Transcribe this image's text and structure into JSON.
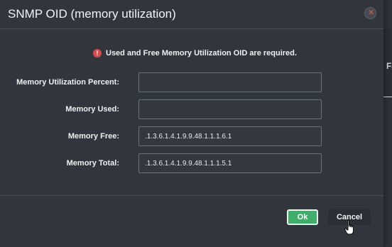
{
  "background": {
    "partial_text": "Fa"
  },
  "dialog": {
    "title": "SNMP OID (memory utilization)",
    "close_icon": "close-icon",
    "alert": {
      "icon": "error-icon",
      "text": "Used and Free Memory Utilization OID are required."
    },
    "fields": [
      {
        "label": "Memory Utilization Percent:",
        "value": ""
      },
      {
        "label": "Memory Used:",
        "value": ""
      },
      {
        "label": "Memory Free:",
        "value": ".1.3.6.1.4.1.9.9.48.1.1.1.6.1"
      },
      {
        "label": "Memory Total:",
        "value": ".1.3.6.1.4.1.9.9.48.1.1.1.5.1"
      }
    ],
    "buttons": {
      "ok_label": "Ok",
      "cancel_label": "Cancel"
    }
  },
  "colors": {
    "ok_button": "#3fae6a",
    "alert_icon": "#d64b4b",
    "close_icon": "#e05a5a"
  }
}
